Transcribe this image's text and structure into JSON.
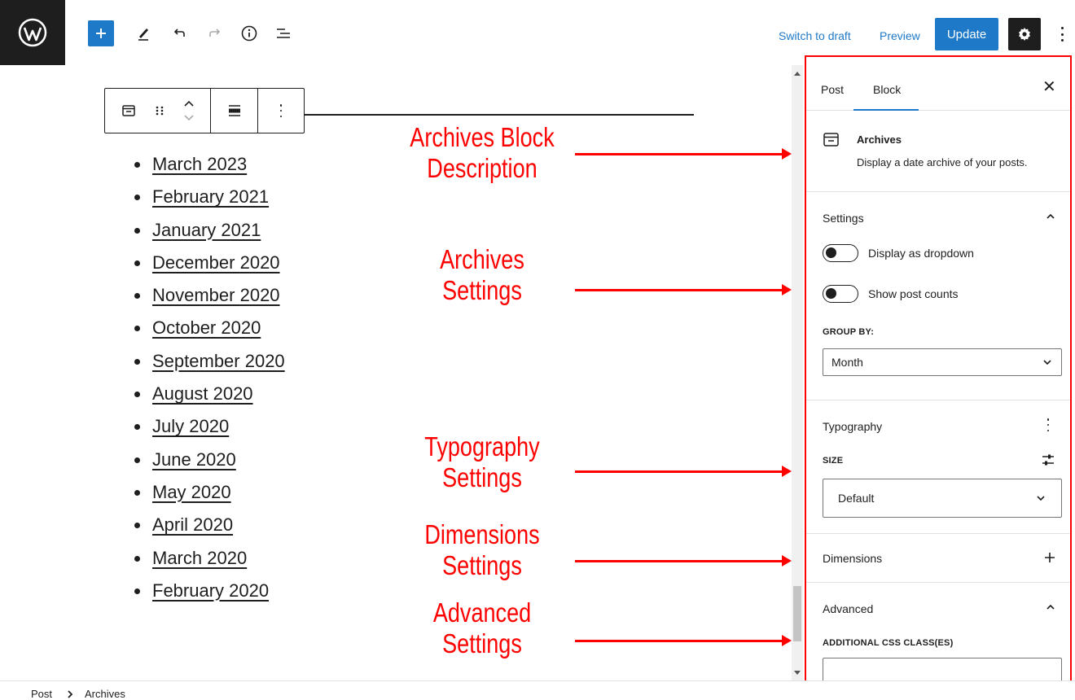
{
  "toolbar": {
    "switch_to_draft": "Switch to draft",
    "preview": "Preview",
    "update": "Update",
    "icons": [
      "wordpress-logo",
      "plus-icon",
      "pencil-icon",
      "undo-icon",
      "redo-icon",
      "info-icon",
      "list-view-icon",
      "gear-icon",
      "kebab-icon"
    ]
  },
  "editor": {
    "archives": [
      "March 2023",
      "February 2021",
      "January 2021",
      "December 2020",
      "November 2020",
      "October 2020",
      "September 2020",
      "August 2020",
      "July 2020",
      "June 2020",
      "May 2020",
      "April 2020",
      "March 2020",
      "February 2020"
    ]
  },
  "annotations": {
    "description": [
      "Archives Block",
      "Description"
    ],
    "settings": [
      "Archives",
      "Settings"
    ],
    "typography": [
      "Typography",
      "Settings"
    ],
    "dimensions": [
      "Dimensions",
      "Settings"
    ],
    "advanced": [
      "Advanced",
      "Settings"
    ],
    "color": "#ff0000"
  },
  "sidebar": {
    "tabs": [
      "Post",
      "Block"
    ],
    "active_tab": "Block",
    "block": {
      "title": "Archives",
      "description": "Display a date archive of your posts."
    },
    "settings": {
      "title": "Settings",
      "toggles": [
        "Display as dropdown",
        "Show post counts"
      ],
      "group_by_label": "GROUP BY:",
      "group_by_value": "Month"
    },
    "typography": {
      "title": "Typography",
      "size_label": "SIZE",
      "size_value": "Default"
    },
    "dimensions": {
      "title": "Dimensions"
    },
    "advanced": {
      "title": "Advanced",
      "css_label": "ADDITIONAL CSS CLASS(ES)",
      "css_value": ""
    }
  },
  "footer": {
    "breadcrumb": [
      "Post",
      "Archives"
    ]
  },
  "colors": {
    "accent": "#1e79c8",
    "dark": "#1e1e1e"
  }
}
